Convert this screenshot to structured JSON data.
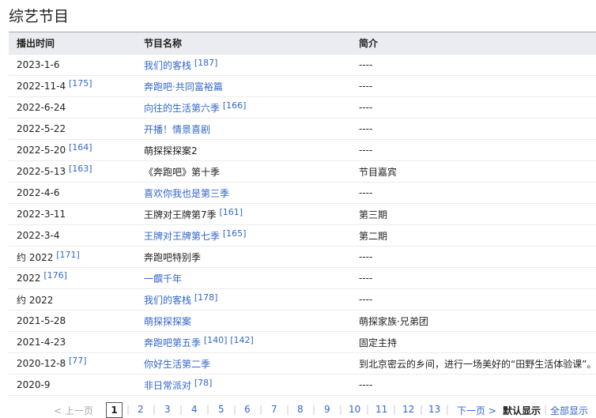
{
  "page": {
    "title": "综艺节目"
  },
  "table": {
    "headers": [
      "播出时间",
      "节目名称",
      "简介"
    ],
    "rows": [
      {
        "date": "2023-1-6",
        "date_ref": "",
        "name": "我们的客栈",
        "name_link": true,
        "name_ref": "[187]",
        "name_ref2": "",
        "desc": "----"
      },
      {
        "date": "2022-11-4",
        "date_ref": "[175]",
        "name": "奔跑吧·共同富裕篇",
        "name_link": true,
        "name_ref": "",
        "name_ref2": "",
        "desc": "----"
      },
      {
        "date": "2022-6-24",
        "date_ref": "",
        "name": "向往的生活第六季",
        "name_link": true,
        "name_ref": "[166]",
        "name_ref2": "",
        "desc": "----"
      },
      {
        "date": "2022-5-22",
        "date_ref": "",
        "name": "开播！情景喜剧",
        "name_link": true,
        "name_ref": "",
        "name_ref2": "",
        "desc": "----"
      },
      {
        "date": "2022-5-20",
        "date_ref": "[164]",
        "name": "萌探探探案2",
        "name_link": false,
        "name_ref": "",
        "name_ref2": "",
        "desc": "----"
      },
      {
        "date": "2022-5-13",
        "date_ref": "[163]",
        "name": "《奔跑吧》第十季",
        "name_link": false,
        "name_ref": "",
        "name_ref2": "",
        "desc": "节目嘉宾"
      },
      {
        "date": "2022-4-6",
        "date_ref": "",
        "name": "喜欢你我也是第三季",
        "name_link": true,
        "name_ref": "",
        "name_ref2": "",
        "desc": "----"
      },
      {
        "date": "2022-3-11",
        "date_ref": "",
        "name": "王牌对王牌第7季",
        "name_link": false,
        "name_ref": "[161]",
        "name_ref2": "",
        "desc": "第三期"
      },
      {
        "date": "2022-3-4",
        "date_ref": "",
        "name": "王牌对王牌第七季",
        "name_link": true,
        "name_ref": "[165]",
        "name_ref2": "",
        "desc": "第二期"
      },
      {
        "date": "约 2022",
        "date_ref": "[171]",
        "name": "奔跑吧特别季",
        "name_link": false,
        "name_ref": "",
        "name_ref2": "",
        "desc": "----"
      },
      {
        "date": "2022",
        "date_ref": "[176]",
        "name": "一饌千年",
        "name_link": true,
        "name_ref": "",
        "name_ref2": "",
        "desc": "----"
      },
      {
        "date": "约 2022",
        "date_ref": "",
        "name": "我们的客栈",
        "name_link": true,
        "name_ref": "[178]",
        "name_ref2": "",
        "desc": "----"
      },
      {
        "date": "2021-5-28",
        "date_ref": "",
        "name": "萌探探探案",
        "name_link": true,
        "name_ref": "",
        "name_ref2": "",
        "desc": "萌探家族·兄弟团"
      },
      {
        "date": "2021-4-23",
        "date_ref": "",
        "name": "奔跑吧第五季",
        "name_link": true,
        "name_ref": "[140]",
        "name_ref2": "[142]",
        "desc": "固定主持"
      },
      {
        "date": "2020-12-8",
        "date_ref": "[77]",
        "name": "你好生活第二季",
        "name_link": true,
        "name_ref": "",
        "name_ref2": "",
        "desc": "到北京密云的乡间，进行一场美好的“田野生活体验课”。"
      },
      {
        "date": "2020-9",
        "date_ref": "",
        "name": "非日常派对",
        "name_link": true,
        "name_ref": "[78]",
        "name_ref2": "",
        "desc": "----"
      }
    ]
  },
  "pagination": {
    "prev": "< 上一页",
    "current": "1",
    "pages": [
      "2",
      "3",
      "4",
      "5",
      "6",
      "7",
      "8",
      "9",
      "10",
      "11",
      "12",
      "13"
    ],
    "next": "下一页 >",
    "default_view": "默认显示",
    "show_all": "全部显示",
    "separator": "|"
  },
  "colors": {
    "link": "#3366cc",
    "header_bg": "#eaecf0",
    "text": "#222222"
  }
}
